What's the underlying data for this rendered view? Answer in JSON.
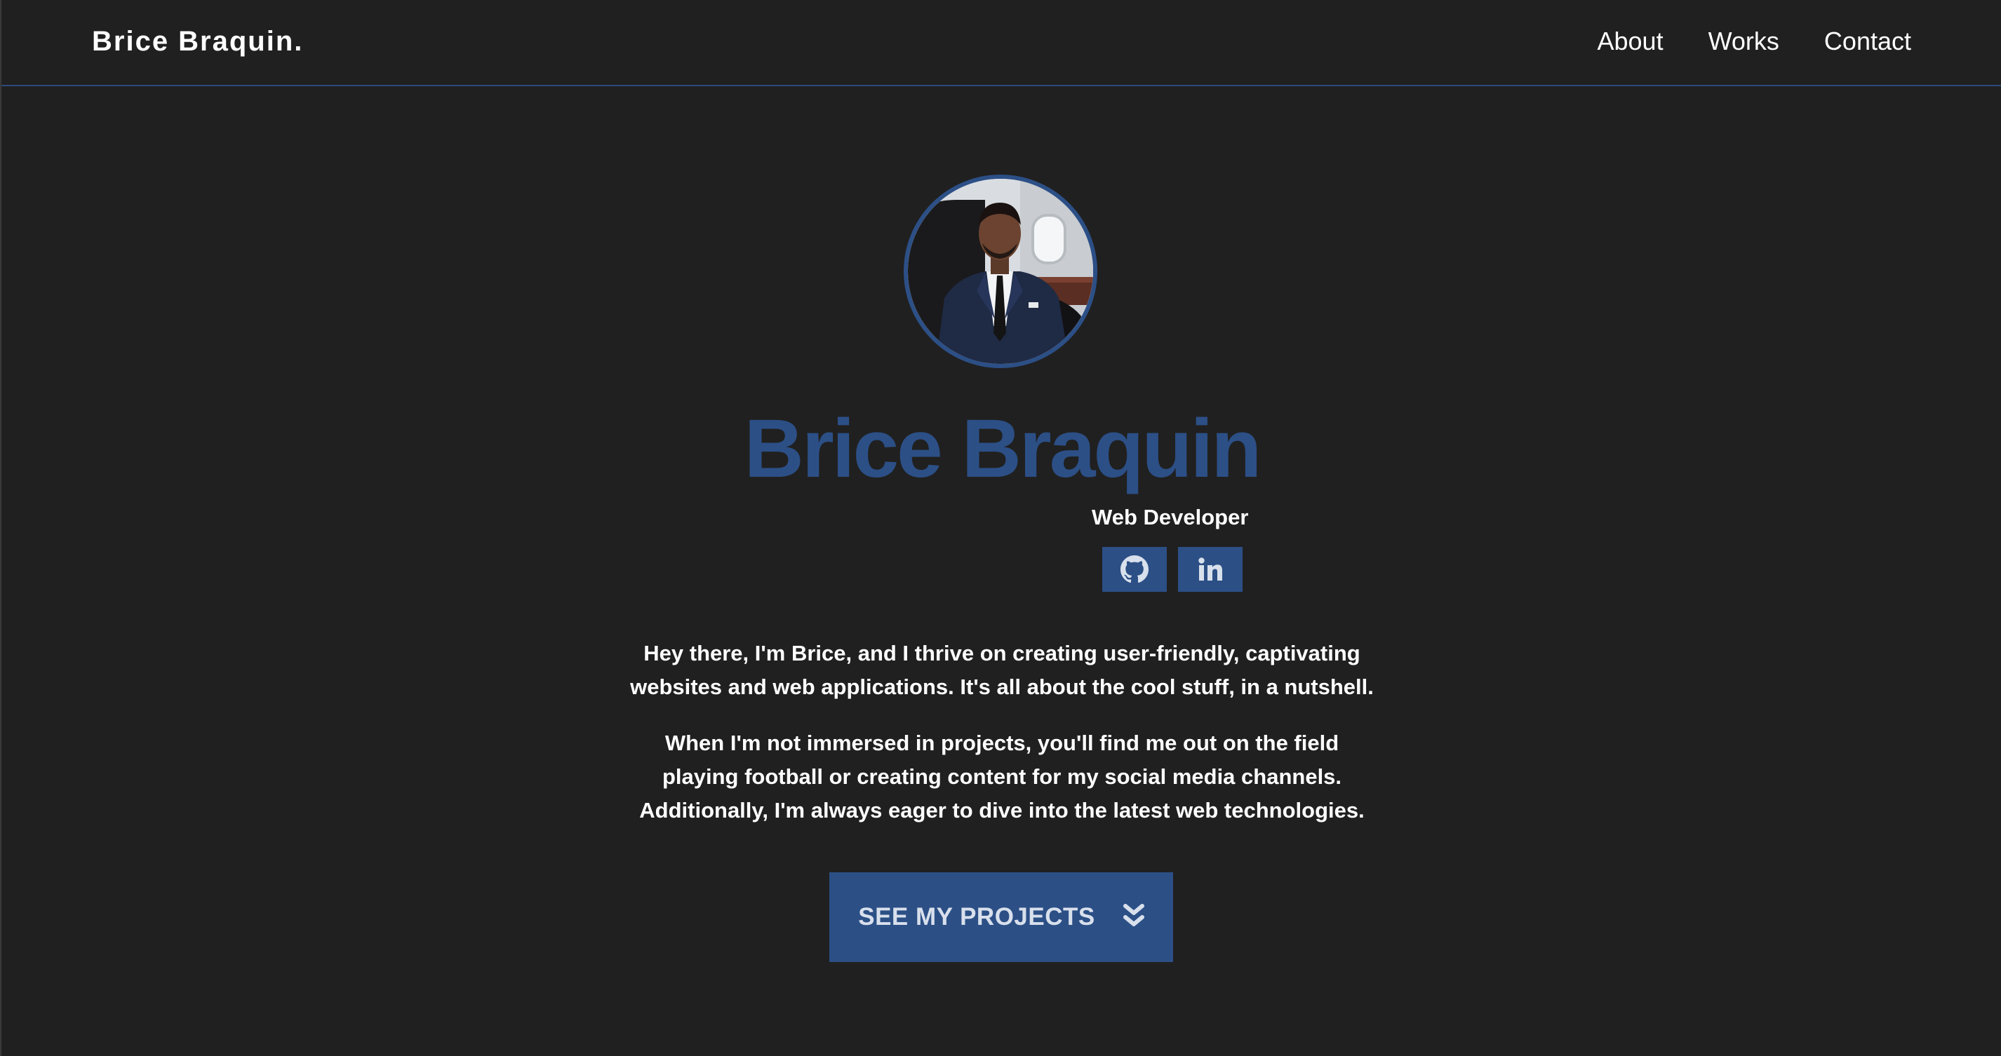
{
  "header": {
    "brand": "Brice Braquin.",
    "nav": [
      {
        "label": "About"
      },
      {
        "label": "Works"
      },
      {
        "label": "Contact"
      }
    ]
  },
  "hero": {
    "name": "Brice Braquin",
    "role": "Web Developer",
    "socials": [
      {
        "icon": "github-icon"
      },
      {
        "icon": "linkedin-icon"
      }
    ],
    "bio": [
      [
        "Hey there, I'm Brice, and I thrive on creating user-friendly, captivating",
        "websites and web applications. It's all about the cool stuff, in a nutshell."
      ],
      [
        "When I'm not immersed in projects, you'll find me out on the field",
        "playing football or creating content for my social media channels.",
        "Additionally, I'm always eager to dive into the latest web technologies."
      ]
    ],
    "cta_label": "SEE MY PROJECTS",
    "cta_icon": "double-chevron-down-icon"
  },
  "colors": {
    "background": "#202020",
    "accent": "#2c4f86",
    "text": "#ffffff"
  }
}
